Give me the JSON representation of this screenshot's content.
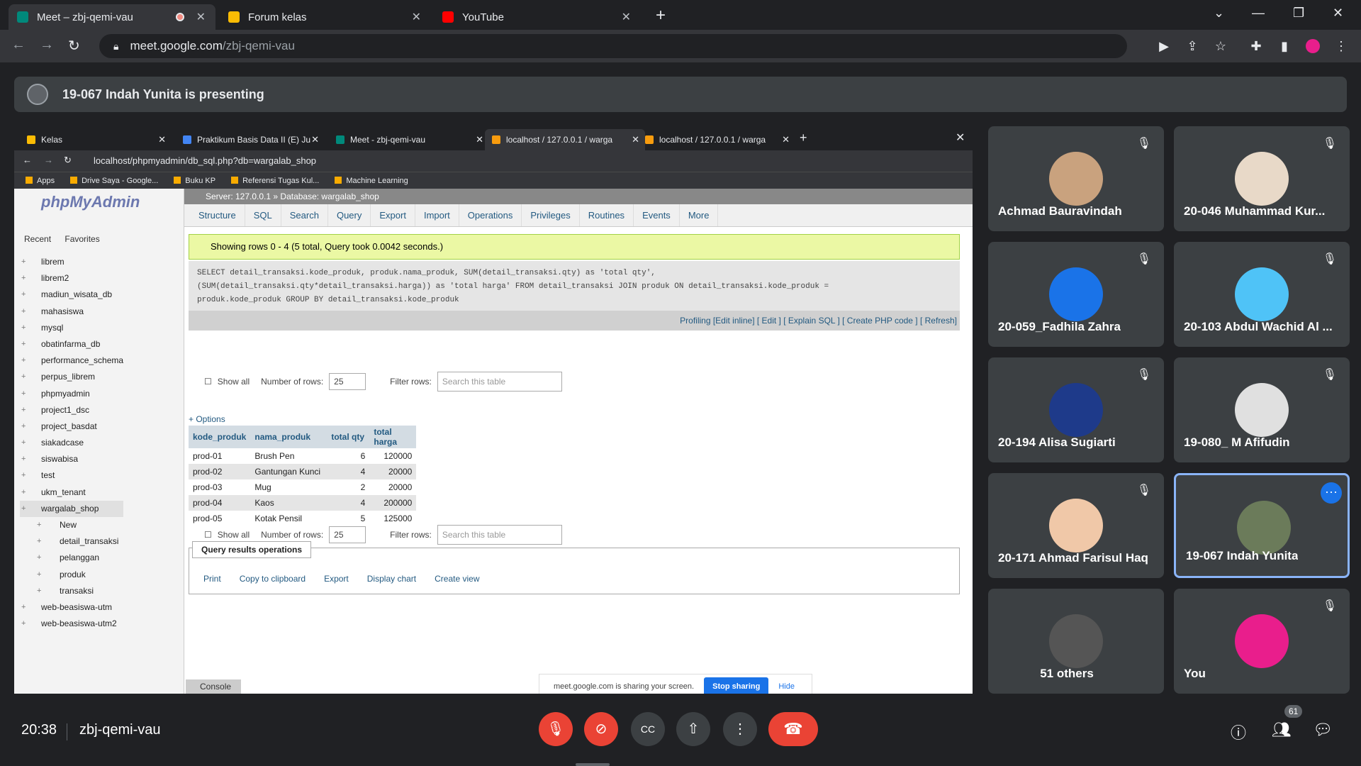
{
  "browser": {
    "tabs": [
      {
        "label": "Meet – zbj-qemi-vau",
        "active": true,
        "recording": true
      },
      {
        "label": "Forum kelas",
        "active": false
      },
      {
        "label": "YouTube",
        "active": false
      }
    ],
    "url_host": "meet.google.com",
    "url_path": "/zbj-qemi-vau"
  },
  "banner": {
    "text": "19-067 Indah Yunita is presenting"
  },
  "shared": {
    "tabs": [
      {
        "label": "Kelas"
      },
      {
        "label": "Praktikum Basis Data II (E) Ju"
      },
      {
        "label": "Meet - zbj-qemi-vau"
      },
      {
        "label": "localhost / 127.0.0.1 / warga"
      },
      {
        "label": "localhost / 127.0.0.1 / warga"
      }
    ],
    "url": "localhost/phpmyadmin/db_sql.php?db=wargalab_shop",
    "bookmarks": [
      "Apps",
      "Drive Saya - Google...",
      "Buku KP",
      "Referensi Tugas Kul...",
      "Machine Learning"
    ],
    "pma": {
      "logo": "phpMyAdmin",
      "recent": "Recent",
      "favorites": "Favorites",
      "databases": [
        "librem",
        "librem2",
        "madiun_wisata_db",
        "mahasiswa",
        "mysql",
        "obatinfarma_db",
        "performance_schema",
        "perpus_librem",
        "phpmyadmin",
        "project1_dsc",
        "project_basdat",
        "siakadcase",
        "siswabisa",
        "test",
        "ukm_tenant",
        "wargalab_shop"
      ],
      "subitems": [
        "New",
        "detail_transaksi",
        "pelanggan",
        "produk",
        "transaksi"
      ],
      "databases_after": [
        "web-beasiswa-utm",
        "web-beasiswa-utm2"
      ],
      "breadcrumb": "Server: 127.0.0.1 » Database: wargalab_shop",
      "menu": [
        "Structure",
        "SQL",
        "Search",
        "Query",
        "Export",
        "Import",
        "Operations",
        "Privileges",
        "Routines",
        "Events",
        "More"
      ],
      "success": "Showing rows 0 - 4 (5 total, Query took 0.0042 seconds.)",
      "sql_lines": [
        "SELECT detail_transaksi.kode_produk, produk.nama_produk, SUM(detail_transaksi.qty) as 'total qty',",
        "(SUM(detail_transaksi.qty*detail_transaksi.harga)) as 'total harga' FROM detail_transaksi JOIN produk ON detail_transaksi.kode_produk =",
        "produk.kode_produk GROUP BY detail_transaksi.kode_produk"
      ],
      "profiling": "Profiling [Edit inline] [ Edit ] [ Explain SQL ] [ Create PHP code ] [ Refresh]",
      "show_all": "Show all",
      "num_rows_label": "Number of rows:",
      "num_rows_value": "25",
      "filter_label": "Filter rows:",
      "filter_placeholder": "Search this table",
      "options": "+ Options",
      "columns": [
        "kode_produk",
        "nama_produk",
        "total qty",
        "total harga"
      ],
      "rows": [
        [
          "prod-01",
          "Brush Pen",
          "6",
          "120000"
        ],
        [
          "prod-02",
          "Gantungan Kunci",
          "4",
          "20000"
        ],
        [
          "prod-03",
          "Mug",
          "2",
          "20000"
        ],
        [
          "prod-04",
          "Kaos",
          "4",
          "200000"
        ],
        [
          "prod-05",
          "Kotak Pensil",
          "5",
          "125000"
        ]
      ],
      "qro_title": "Query results operations",
      "qro_actions": [
        "Print",
        "Copy to clipboard",
        "Export",
        "Display chart",
        "Create view"
      ],
      "console": "Console"
    },
    "sharebar": {
      "text": "meet.google.com is sharing your screen.",
      "stop": "Stop sharing",
      "hide": "Hide"
    }
  },
  "participants": [
    {
      "name": "Achmad Bauravindah",
      "color": "#c9a27e"
    },
    {
      "name": "20-046 Muhammad Kur...",
      "color": "#e8d9c8"
    },
    {
      "name": "20-059_Fadhila Zahra",
      "color": "#1a73e8"
    },
    {
      "name": "20-103 Abdul Wachid Al ...",
      "color": "#4fc3f7"
    },
    {
      "name": "20-194 Alisa Sugiarti",
      "color": "#1e3a8a"
    },
    {
      "name": "19-080_ M Afifudin",
      "color": "#e0e0e0"
    },
    {
      "name": "20-171 Ahmad Farisul Haq",
      "color": "#f0c8a8"
    },
    {
      "name": "19-067 Indah Yunita",
      "color": "#6b7b5a"
    },
    {
      "name": "51 others",
      "color": "#555"
    },
    {
      "name": "You",
      "color": "#e91e8c"
    }
  ],
  "bottom": {
    "time": "20:38",
    "meeting": "zbj-qemi-vau",
    "people_count": "61"
  }
}
